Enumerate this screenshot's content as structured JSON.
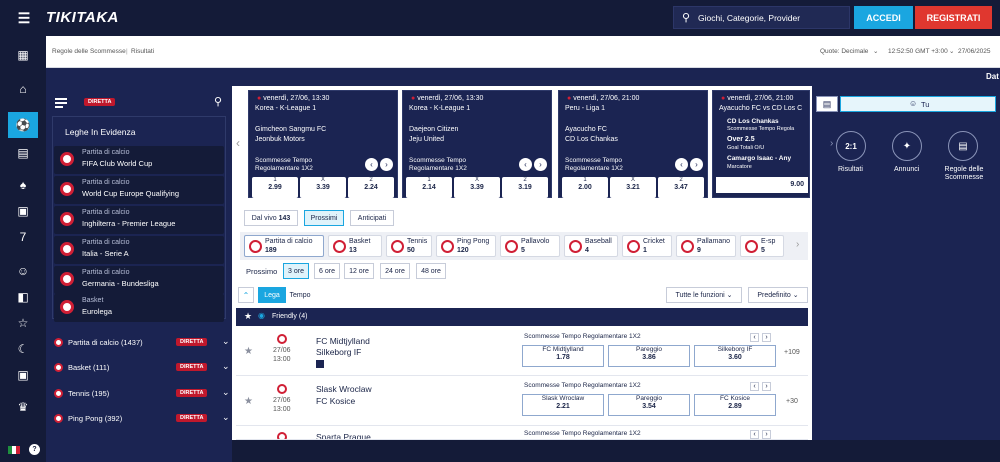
{
  "header": {
    "logo": "TIKITAKA",
    "search_placeholder": "Giochi, Categorie, Provider",
    "login_label": "ACCEDI",
    "register_label": "REGISTRATI",
    "colors": {
      "accent_blue": "#1aa6e0",
      "accent_red": "#e0372f"
    }
  },
  "subbar": {
    "breadcrumb_rules": "Regole delle Scommesse",
    "breadcrumb_results": "Risultati",
    "odds_label": "Quote: Decimale",
    "time": "12:52:50 GMT +3:00",
    "date": "27/06/2025"
  },
  "strip": {
    "text": "Dat"
  },
  "left": {
    "live_badge": "DIRETTA",
    "section_title": "Leghe In Evidenza",
    "highlights": [
      {
        "kind": "Partita di calcio",
        "name": "FIFA Club World Cup"
      },
      {
        "kind": "Partita di calcio",
        "name": "World Cup Europe Qualifying"
      },
      {
        "kind": "Partita di calcio",
        "name": "Inghilterra - Premier League"
      },
      {
        "kind": "Partita di calcio",
        "name": "Italia - Serie A"
      },
      {
        "kind": "Partita di calcio",
        "name": "Germania - Bundesliga"
      },
      {
        "kind": "Basket",
        "name": "Eurolega"
      }
    ],
    "sports": [
      {
        "name": "Partita di calcio (1437)",
        "badge": "DIRETTA"
      },
      {
        "name": "Basket (111)",
        "badge": "DIRETTA"
      },
      {
        "name": "Tennis (195)",
        "badge": "DIRETTA"
      },
      {
        "name": "Ping Pong (392)",
        "badge": "DIRETTA"
      }
    ]
  },
  "cards": [
    {
      "time": "venerdì, 27/06, 13:30",
      "league": "Korea - K-League 1",
      "team1": "Gimcheon Sangmu FC",
      "team2": "Jeonbuk Motors",
      "market1": "Scommesse Tempo",
      "market2": "Regolamentare 1X2",
      "odds": [
        {
          "k": "1",
          "v": "2.99"
        },
        {
          "k": "X",
          "v": "3.39"
        },
        {
          "k": "2",
          "v": "2.24"
        }
      ]
    },
    {
      "time": "venerdì, 27/06, 13:30",
      "league": "Korea - K-League 1",
      "team1": "Daejeon Citizen",
      "team2": "Jeju United",
      "market1": "Scommesse Tempo",
      "market2": "Regolamentare 1X2",
      "odds": [
        {
          "k": "1",
          "v": "2.14"
        },
        {
          "k": "X",
          "v": "3.39"
        },
        {
          "k": "2",
          "v": "3.19"
        }
      ]
    },
    {
      "time": "venerdì, 27/06, 21:00",
      "league": "Peru - Liga 1",
      "team1": "Ayacucho FC",
      "team2": "CD Los Chankas",
      "market1": "Scommesse Tempo",
      "market2": "Regolamentare 1X2",
      "odds": [
        {
          "k": "1",
          "v": "2.00"
        },
        {
          "k": "X",
          "v": "3.21"
        },
        {
          "k": "2",
          "v": "3.47"
        }
      ]
    }
  ],
  "card4": {
    "time": "venerdì, 27/06, 21:00",
    "title": "Ayacucho FC vs CD Los C",
    "line1": "CD Los Chankas",
    "line2": "Scommesse Tempo Regola",
    "line3": "Over 2.5",
    "line4": "Goal Totali O/U",
    "line5": "Camargo Isaac - Any",
    "line6": "Marcatore",
    "odd": "9.00"
  },
  "tabs": {
    "live": "Dal vivo",
    "live_count": "143",
    "next": "Prossimi",
    "early": "Anticipati"
  },
  "sports_bar": [
    {
      "name": "Partita di calcio",
      "count": "189"
    },
    {
      "name": "Basket",
      "count": "13"
    },
    {
      "name": "Tennis",
      "count": "50"
    },
    {
      "name": "Ping Pong",
      "count": "120"
    },
    {
      "name": "Pallavolo",
      "count": "5"
    },
    {
      "name": "Baseball",
      "count": "4"
    },
    {
      "name": "Cricket",
      "count": "1"
    },
    {
      "name": "Pallamano",
      "count": "9"
    },
    {
      "name": "E-sp",
      "count": "5"
    }
  ],
  "time_filter": {
    "label": "Prossimo",
    "options": [
      "3 ore",
      "6 ore",
      "12 ore",
      "24 ore",
      "48 ore"
    ]
  },
  "controls": {
    "lega": "Lega",
    "tempo": "Tempo",
    "all_functions": "Tutte le funzioni",
    "default": "Predefinito"
  },
  "group": {
    "title": "Friendly",
    "count": "(4)"
  },
  "matches": [
    {
      "date": "27/06",
      "time": "13:00",
      "team1": "FC Midtjylland",
      "team2": "Silkeborg IF",
      "market": "Scommesse Tempo Regolamentare 1X2",
      "odds": [
        {
          "k": "FC Midtjylland",
          "v": "1.78"
        },
        {
          "k": "Pareggio",
          "v": "3.86"
        },
        {
          "k": "Silkeborg IF",
          "v": "3.60"
        }
      ],
      "more": "+109"
    },
    {
      "date": "27/06",
      "time": "13:00",
      "team1": "Slask Wroclaw",
      "team2": "FC Kosice",
      "market": "Scommesse Tempo Regolamentare 1X2",
      "odds": [
        {
          "k": "Slask Wroclaw",
          "v": "2.21"
        },
        {
          "k": "Pareggio",
          "v": "3.54"
        },
        {
          "k": "FC Kosice",
          "v": "2.89"
        }
      ],
      "more": "+30"
    },
    {
      "team1": "Sparta Prague",
      "market": "Scommesse Tempo Regolamentare 1X2"
    }
  ],
  "right": {
    "user_label": "Tu",
    "results_label": "Risultati",
    "news_label": "Annunci",
    "rules_label": "Regole delle Scommesse",
    "results_icon": "2:1"
  },
  "icons": [
    "menu-icon",
    "search-icon",
    "user-icon",
    "star-icon",
    "chevron-down-icon",
    "chevron-left-icon",
    "chevron-right-icon",
    "flag-italy-icon",
    "help-icon"
  ]
}
